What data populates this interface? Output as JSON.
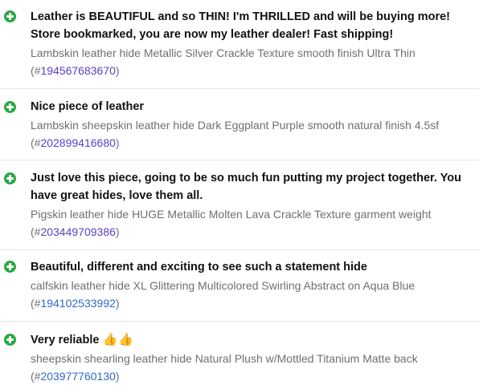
{
  "colors": {
    "positive_icon": "#28a745",
    "link": "#3366cc",
    "visited_link": "#5a3fc4",
    "thumbs_emoji": "#f2b01e",
    "description_text": "#6f6f6f"
  },
  "feedback": [
    {
      "icon": "plus-circle-icon",
      "comment": "Leather is BEAUTIFUL and so THIN! I'm THRILLED and will be buying more! Store bookmarked, you are now my leather dealer! Fast shipping!",
      "item_title": "Lambskin leather hide Metallic Silver Crackle Texture smooth finish Ultra Thin",
      "ref_prefix": "(#",
      "item_number": "194567683670",
      "ref_suffix": ")"
    },
    {
      "icon": "plus-circle-icon",
      "comment": "Nice piece of leather",
      "item_title": "Lambskin sheepskin leather hide Dark Eggplant Purple smooth natural finish 4.5sf",
      "ref_prefix": "(#",
      "item_number": "202899416680",
      "ref_suffix": ")"
    },
    {
      "icon": "plus-circle-icon",
      "comment": "Just love this piece, going to be so much fun putting my project together. You have great hides, love them all.",
      "item_title": "Pigskin leather hide HUGE Metallic Molten Lava Crackle Texture garment weight",
      "ref_prefix": "(#",
      "item_number": "203449709386",
      "ref_suffix": ")"
    },
    {
      "icon": "plus-circle-icon",
      "comment": "Beautiful, different and exciting to see such a statement hide",
      "item_title": "calfskin leather hide XL Glittering Multicolored Swirling Abstract on Aqua Blue",
      "ref_prefix": "(#",
      "item_number": "194102533992",
      "ref_suffix": ")"
    },
    {
      "icon": "plus-circle-icon",
      "comment": "Very reliable",
      "emoji": "👍👍",
      "item_title": "sheepskin shearling leather hide Natural Plush w/Mottled Titanium Matte back",
      "ref_prefix": "(#",
      "item_number": "203977760130",
      "ref_suffix": ")"
    }
  ]
}
